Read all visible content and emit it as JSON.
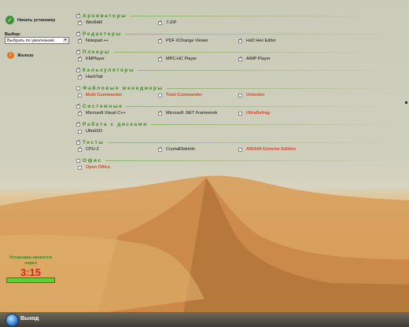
{
  "left_panel": {
    "start_install_label": "Начать установку",
    "choose_label": "Выбор:",
    "select_value": "Выбрать по умолчанию",
    "hardware_label": "Железо",
    "countdown_label": "Установка начнется через",
    "countdown_time": "3:15",
    "progress": 1.0
  },
  "taskbar": {
    "exit_label": "Выход"
  },
  "categories": [
    {
      "title": "Архиваторы",
      "checked": true,
      "items": [
        {
          "label": "WinRAR",
          "checked": true,
          "available": true
        },
        {
          "label": "7-ZIP",
          "checked": true,
          "available": true
        }
      ]
    },
    {
      "title": "Редакторы",
      "checked": true,
      "items": [
        {
          "label": "Notepad ++",
          "checked": true,
          "available": true
        },
        {
          "label": "PDF XChange Viewer",
          "checked": true,
          "available": true
        },
        {
          "label": "HxD Hex Editor",
          "checked": true,
          "available": true
        }
      ]
    },
    {
      "title": "Плееры",
      "checked": true,
      "items": [
        {
          "label": "KMPlayer",
          "checked": true,
          "available": true
        },
        {
          "label": "MPC-HC Player",
          "checked": true,
          "available": true
        },
        {
          "label": "AIMP Player",
          "checked": true,
          "available": true
        }
      ]
    },
    {
      "title": "Калькуляторы",
      "checked": true,
      "items": [
        {
          "label": "HashTab",
          "checked": true,
          "available": true
        }
      ]
    },
    {
      "title": "Файловые менеджеры",
      "checked": false,
      "items": [
        {
          "label": "Multi Commander",
          "checked": false,
          "available": false
        },
        {
          "label": "Total Commander",
          "checked": false,
          "available": false
        },
        {
          "label": "Unlocker",
          "checked": false,
          "available": false
        }
      ]
    },
    {
      "title": "Системные",
      "checked": true,
      "items": [
        {
          "label": "Microsoft Visual C++",
          "checked": true,
          "available": true
        },
        {
          "label": "Microsoft .NET Framework",
          "checked": true,
          "available": true
        },
        {
          "label": "UltraDefrag",
          "checked": false,
          "available": false
        }
      ]
    },
    {
      "title": "Работа с дисками",
      "checked": true,
      "items": [
        {
          "label": "UltraISO",
          "checked": false,
          "available": true
        }
      ]
    },
    {
      "title": "Тесты",
      "checked": true,
      "items": [
        {
          "label": "CPU-Z",
          "checked": true,
          "available": true
        },
        {
          "label": "CrystalDiskInfo",
          "checked": true,
          "available": true
        },
        {
          "label": "AIDA64 Extreme Edition",
          "checked": false,
          "available": false
        }
      ]
    },
    {
      "title": "Офис",
      "checked": false,
      "items": [
        {
          "label": "Open Office",
          "checked": false,
          "available": false
        }
      ]
    }
  ]
}
